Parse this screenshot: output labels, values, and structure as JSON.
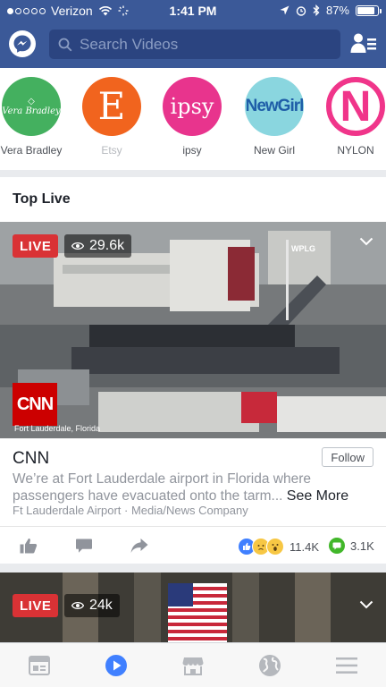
{
  "status_bar": {
    "carrier": "Verizon",
    "time": "1:41 PM",
    "battery": "87%",
    "battery_level": 0.87
  },
  "header": {
    "search_placeholder": "Search Videos"
  },
  "pages": [
    {
      "name": "Vera Bradley",
      "logo_text": "Vera Bradley",
      "color": "#44b05f",
      "faded": false
    },
    {
      "name": "Etsy",
      "logo_text": "E",
      "color": "#f1641e",
      "faded": true
    },
    {
      "name": "ipsy",
      "logo_text": "ipsy",
      "color": "#e8348d",
      "faded": false
    },
    {
      "name": "New Girl",
      "logo_text": "NewGirl",
      "color": "#7fd2dd",
      "faded": false
    },
    {
      "name": "NYLON",
      "logo_text": "N",
      "color": "#f0358a",
      "faded": false
    }
  ],
  "section": {
    "title": "Top Live"
  },
  "post1": {
    "badge": "LIVE",
    "viewers": "29.6k",
    "overlay_station": "WPLG",
    "overlay_logo": "CNN",
    "overlay_location": "Fort Lauderdale, Florida",
    "source": "CNN",
    "follow_label": "Follow",
    "description": "We’re at Fort Lauderdale airport in Florida where passengers have evacuated onto the tarm...",
    "see_more": "See More",
    "meta": "Ft Lauderdale Airport · Media/News Company",
    "reactions_count": "11.4K",
    "comments_count": "3.1K"
  },
  "post2": {
    "badge": "LIVE",
    "viewers": "24k"
  },
  "colors": {
    "brand_blue": "#3b5998",
    "live_red": "#d93235",
    "active_tab": "#4080ff"
  },
  "tabs": [
    "news-feed",
    "video",
    "marketplace",
    "notifications",
    "menu"
  ]
}
